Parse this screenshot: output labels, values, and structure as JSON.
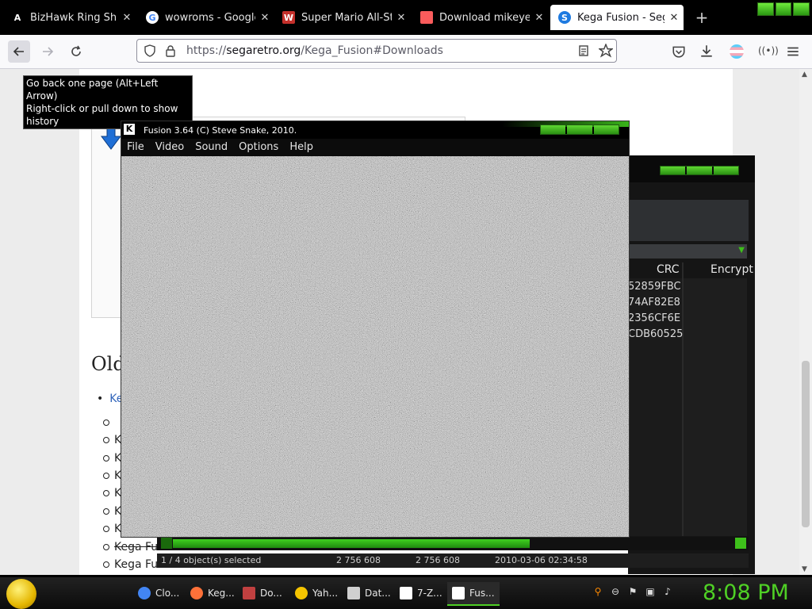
{
  "browser": {
    "tabs": [
      {
        "title": "BizHawk Ring Shuffle",
        "favicon": "A"
      },
      {
        "title": "wowroms - Google Se",
        "favicon": "G"
      },
      {
        "title": "Super Mario All-Stars",
        "favicon": "W"
      },
      {
        "title": "Download mikeyelde",
        "favicon": "itch"
      },
      {
        "title": "Kega Fusion - Sega R",
        "favicon": "S",
        "active": true
      }
    ],
    "url_prefix": "https://",
    "url_host": "segaretro.org",
    "url_path": "/Kega_Fusion#Downloads",
    "tooltip_line1": "Go back one page (Alt+Left Arrow)",
    "tooltip_line2": "Right-click or pull down to show history"
  },
  "page": {
    "heading": "Old",
    "bullet": "Ke",
    "sub_items": [
      {
        "text": ""
      },
      {
        "text": "K"
      },
      {
        "text": "K"
      },
      {
        "text": "K"
      },
      {
        "text": "K"
      },
      {
        "text": "K"
      },
      {
        "text": "K"
      },
      {
        "text": "Kega Fu",
        "strike": true
      },
      {
        "text": "Kega Fu"
      }
    ]
  },
  "zip": {
    "col_crc": "CRC",
    "col_encrypt": "Encrypt",
    "crc_values": [
      "52859FBC",
      "74AF82E8",
      "2356CF6E",
      "CDB60525"
    ],
    "status_selected": "1 / 4 object(s) selected",
    "status_size": "2 756 608",
    "status_packed": "2 756 608",
    "status_date": "2010-03-06 02:34:58"
  },
  "fusion": {
    "title": "Fusion 3.64 (C) Steve Snake, 2010.",
    "menu": [
      "File",
      "Video",
      "Sound",
      "Options",
      "Help"
    ]
  },
  "taskbar": {
    "items": [
      {
        "label": "Clo...",
        "color": "#4285f4"
      },
      {
        "label": "Keg...",
        "color": "#ff7139"
      },
      {
        "label": "Do...",
        "color": "#c04040"
      },
      {
        "label": "Yah...",
        "color": "#f5c400"
      },
      {
        "label": "Dat...",
        "color": "#d0d0d0"
      },
      {
        "label": "7-Z...",
        "color": "#ffffff"
      },
      {
        "label": "Fus...",
        "color": "#ffffff",
        "active": true
      }
    ],
    "clock": "8:08 PM"
  }
}
